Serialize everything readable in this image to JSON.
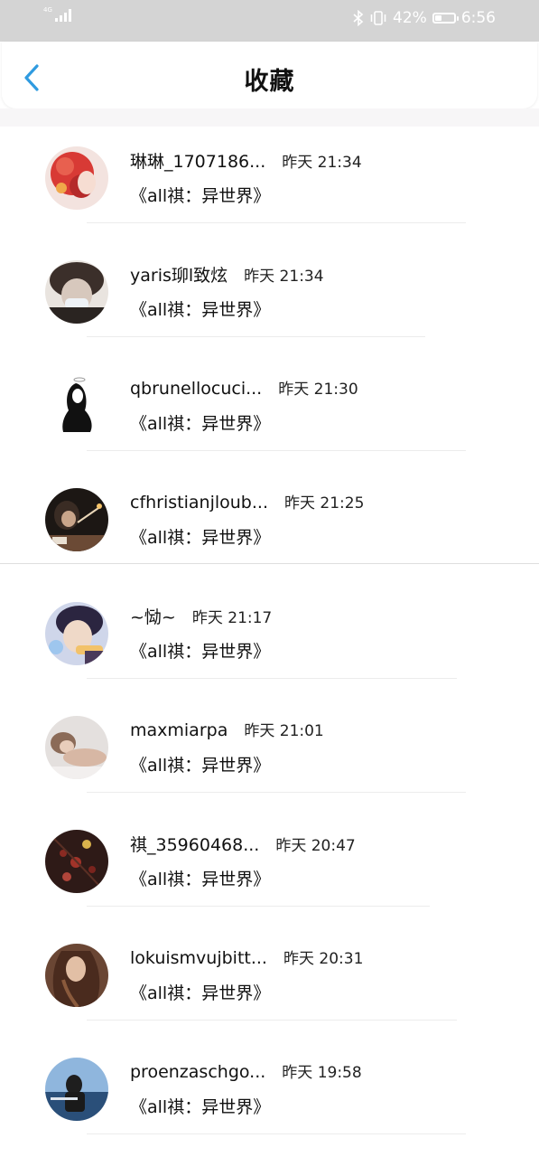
{
  "status_bar": {
    "network": "4G",
    "battery_percent": "42%",
    "battery_level": 0.42,
    "time": "6:56",
    "icons": [
      "signal-icon",
      "bluetooth-icon",
      "vibrate-icon",
      "battery-icon"
    ]
  },
  "header": {
    "title": "收藏",
    "back_icon": "chevron-left-icon",
    "accent_color": "#2f9be0"
  },
  "items": [
    {
      "name": "琳琳_1707186...",
      "time": "昨天 21:34",
      "title": "《all祺：异世界》",
      "avatar": "red-hair-girl"
    },
    {
      "name": "yaris珋l致炫",
      "time": "昨天 21:34",
      "title": "《all祺：异世界》",
      "avatar": "boy-masked"
    },
    {
      "name": "qbrunellocuci...",
      "time": "昨天 21:30",
      "title": "《all祺：异世界》",
      "avatar": "sketch-figure"
    },
    {
      "name": "cfhristianjloub...",
      "time": "昨天 21:25",
      "title": "《all祺：异世界》",
      "avatar": "candle-dark"
    },
    {
      "name": "~恸~",
      "time": "昨天 21:17",
      "title": "《all祺：异世界》",
      "avatar": "boy-purple"
    },
    {
      "name": "maxmiarpa",
      "time": "昨天 21:01",
      "title": "《all祺：异世界》",
      "avatar": "woman-lying"
    },
    {
      "name": "祺_35960468...",
      "time": "昨天 20:47",
      "title": "《all祺：异世界》",
      "avatar": "dark-flowers"
    },
    {
      "name": "lokuismvujbitt...",
      "time": "昨天 20:31",
      "title": "《all祺：异世界》",
      "avatar": "woman-long-hair"
    },
    {
      "name": "proenzaschgo...",
      "time": "昨天 19:58",
      "title": "《all祺：异世界》",
      "avatar": "girl-sea"
    }
  ]
}
